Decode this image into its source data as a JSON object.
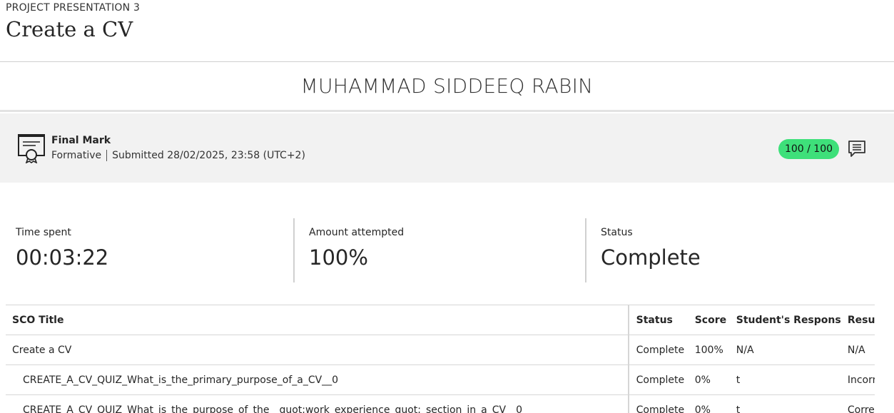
{
  "header": {
    "subtitle": "PROJECT PRESENTATION 3",
    "title": "Create a CV"
  },
  "student": {
    "name": "MUHAMMAD SIDDEEQ RABIN"
  },
  "mark": {
    "icon": "certificate-icon",
    "title": "Final Mark",
    "type": "Formative",
    "submitted": "Submitted 28/02/2025, 23:58 (UTC+2)",
    "score": "100 / 100",
    "score_color": "#3ee07a",
    "feedback_icon": "comment-icon"
  },
  "stats": [
    {
      "label": "Time spent",
      "value": "00:03:22"
    },
    {
      "label": "Amount attempted",
      "value": "100%"
    },
    {
      "label": "Status",
      "value": "Complete"
    }
  ],
  "table": {
    "headers": [
      "SCO Title",
      "Status",
      "Score",
      "Student's Response",
      "Result"
    ],
    "rows": [
      {
        "title": "Create a CV",
        "status": "Complete",
        "score": "100%",
        "response": "N/A",
        "result": "N/A"
      },
      {
        "title": "CREATE_A_CV_QUIZ_What_is_the_primary_purpose_of_a_CV__0",
        "status": "Complete",
        "score": "0%",
        "response": "t",
        "result": "Incorrect"
      },
      {
        "title": "CREATE_A_CV_QUIZ_What_is_the_purpose_of_the__quot;work_experience_quot;_section_in_a_CV__0",
        "status": "Complete",
        "score": "0%",
        "response": "t",
        "result": "Correct"
      }
    ]
  }
}
